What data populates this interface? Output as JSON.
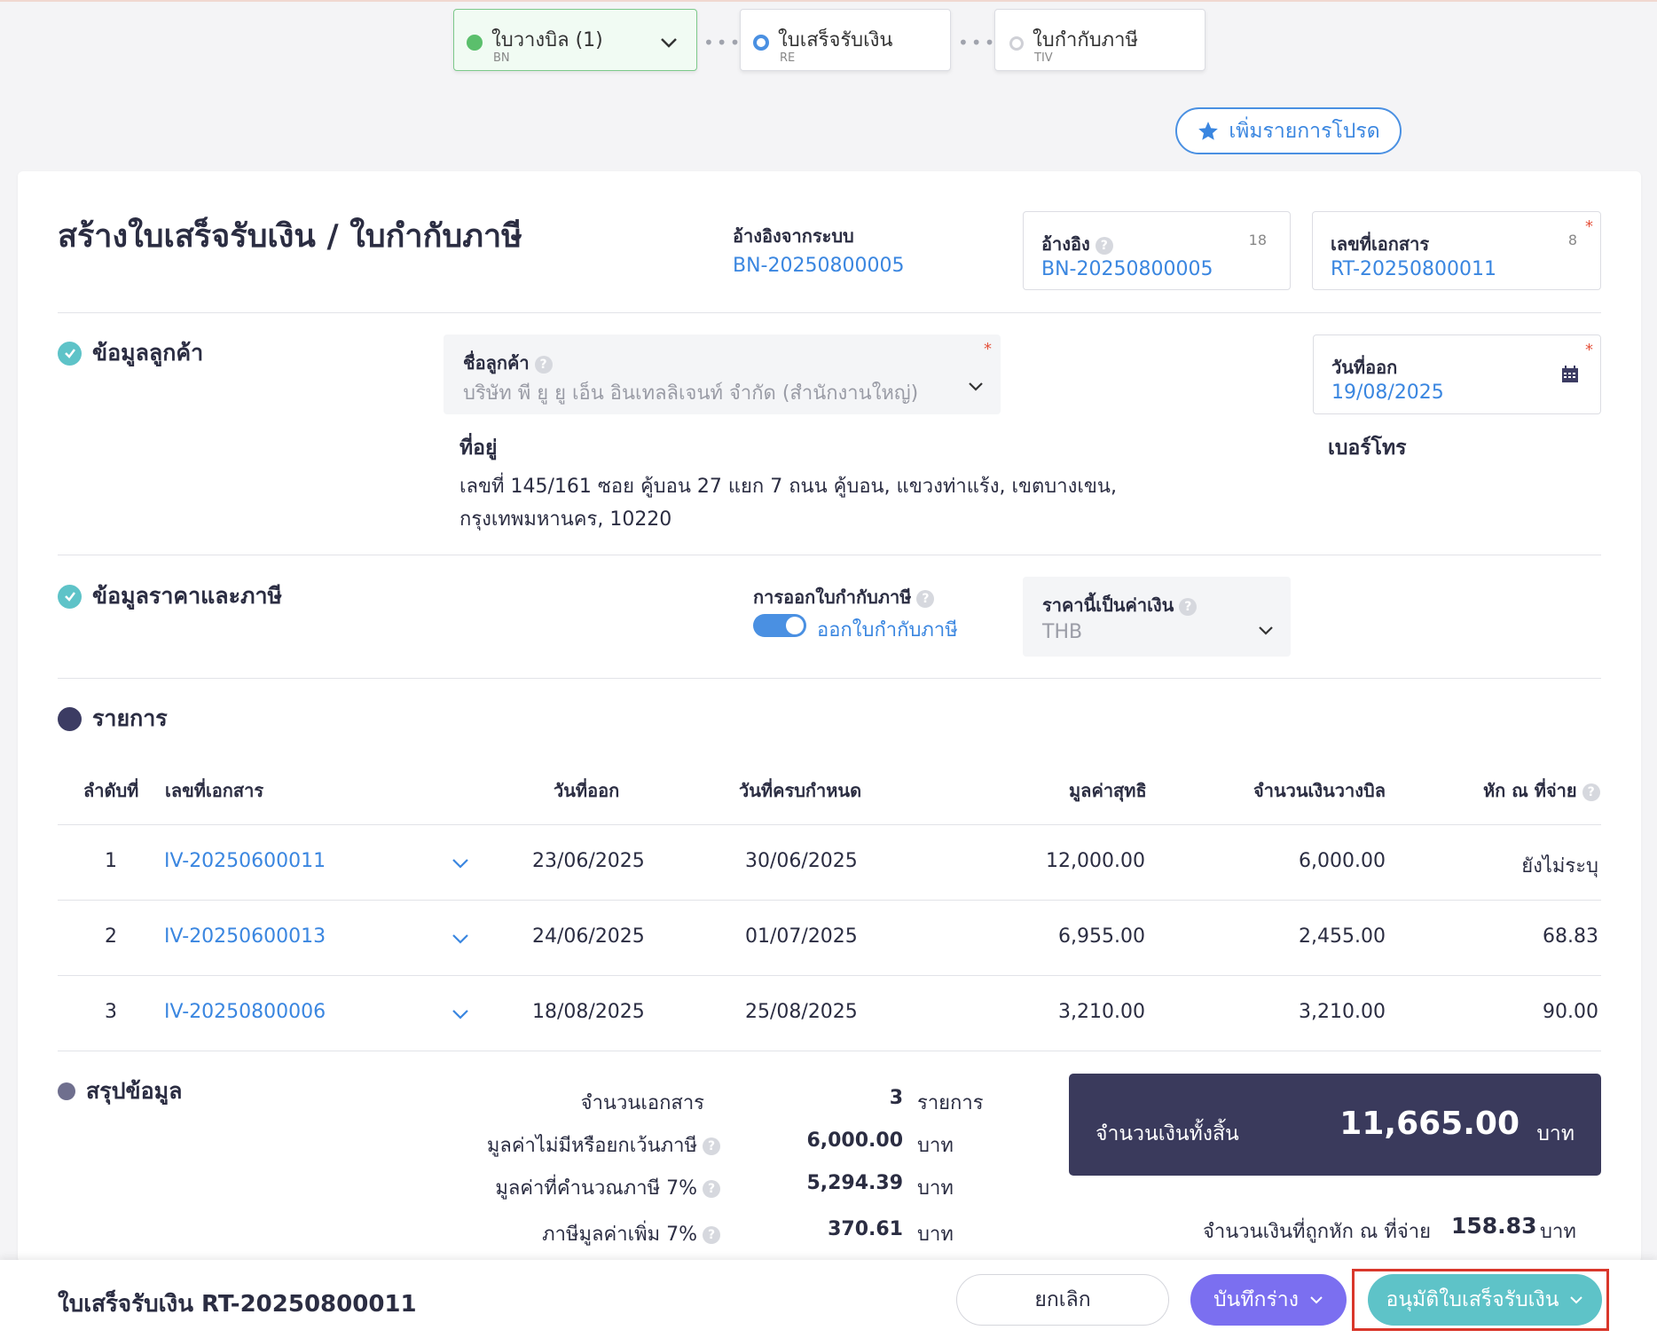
{
  "steps": [
    {
      "label": "ใบวางบิล (1)",
      "sub": "BN"
    },
    {
      "label": "ใบเสร็จรับเงิน",
      "sub": "RE"
    },
    {
      "label": "ใบกำกับภาษี",
      "sub": "TIV"
    }
  ],
  "step_dots": "•••",
  "fav_button": "เพิ่มรายการโปรด",
  "title": "สร้างใบเสร็จรับเงิน / ใบกำกับภาษี",
  "ref_system": {
    "label": "อ้างอิงจากระบบ",
    "value": "BN-20250800005"
  },
  "reference": {
    "label": "อ้างอิง",
    "value": "BN-20250800005",
    "count": "18"
  },
  "doc_no": {
    "label": "เลขที่เอกสาร",
    "value": "RT-20250800011",
    "count": "8"
  },
  "required_mark": "*",
  "help_mark": "?",
  "customer_section": {
    "title": "ข้อมูลลูกค้า",
    "name_label": "ชื่อลูกค้า",
    "name_value": "บริษัท พี ยู ยู เอ็น อินเทลลิเจนท์ จำกัด (สำนักงานใหญ่)",
    "address_label": "ที่อยู่",
    "address": "เลขที่ 145/161 ซอย คู้บอน 27 แยก 7 ถนน คู้บอน, แขวงท่าแร้ง, เขตบางเขน, กรุงเทพมหานคร, 10220",
    "date_label": "วันที่ออก",
    "date_value": "19/08/2025",
    "phone_label": "เบอร์โทร"
  },
  "price_section": {
    "title": "ข้อมูลราคาและภาษี",
    "tax_label": "การออกใบกำกับภาษี",
    "tax_toggle_text": "ออกใบกำกับภาษี",
    "currency_label": "ราคานี้เป็นค่าเงิน",
    "currency_value": "THB"
  },
  "items_section": {
    "title": "รายการ",
    "headers": [
      "ลำดับที่",
      "เลขที่เอกสาร",
      "วันที่ออก",
      "วันที่ครบกำหนด",
      "มูลค่าสุทธิ",
      "จำนวนเงินวางบิล",
      "หัก ณ ที่จ่าย"
    ],
    "rows": [
      {
        "no": "1",
        "doc": "IV-20250600011",
        "issue": "23/06/2025",
        "due": "30/06/2025",
        "net": "12,000.00",
        "billed": "6,000.00",
        "wht": "ยังไม่ระบุ"
      },
      {
        "no": "2",
        "doc": "IV-20250600013",
        "issue": "24/06/2025",
        "due": "01/07/2025",
        "net": "6,955.00",
        "billed": "2,455.00",
        "wht": "68.83"
      },
      {
        "no": "3",
        "doc": "IV-20250800006",
        "issue": "18/08/2025",
        "due": "25/08/2025",
        "net": "3,210.00",
        "billed": "3,210.00",
        "wht": "90.00"
      }
    ]
  },
  "summary": {
    "title": "สรุปข้อมูล",
    "doc_count_label": "จำนวนเอกสาร",
    "doc_count": "3",
    "doc_count_unit": "รายการ",
    "exempt_label": "มูลค่าไม่มีหรือยกเว้นภาษี",
    "exempt_value": "6,000.00",
    "taxable_label": "มูลค่าที่คำนวณภาษี 7%",
    "taxable_value": "5,294.39",
    "vat_label": "ภาษีมูลค่าเพิ่ม 7%",
    "vat_value": "370.61",
    "unit": "บาท",
    "total_label": "จำนวนเงินทั้งสิ้น",
    "total_value": "11,665.00",
    "withheld_label": "จำนวนเงินที่ถูกหัก ณ ที่จ่าย",
    "withheld_value": "158.83"
  },
  "footer": {
    "title": "ใบเสร็จรับเงิน RT-20250800011",
    "cancel": "ยกเลิก",
    "draft": "บันทึกร่าง",
    "approve": "อนุมัติใบเสร็จรับเงิน"
  },
  "colors": {
    "accent_blue": "#3a86e0",
    "teal": "#5ec3c8",
    "purple": "#7b6ff0",
    "navy_total": "#3a3a5c",
    "highlight_red": "#d9372b"
  }
}
